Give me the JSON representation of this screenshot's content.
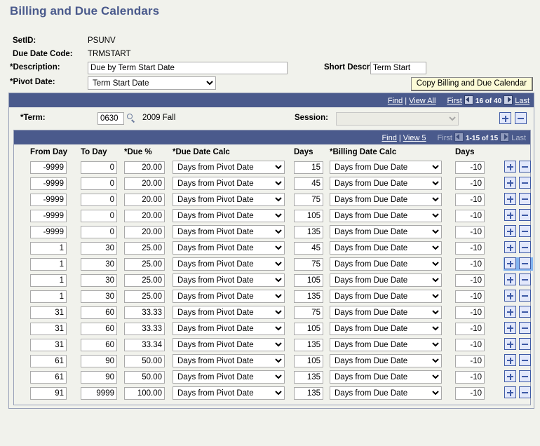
{
  "page": {
    "title": "Billing and Due Calendars"
  },
  "header": {
    "setid_label": "SetID:",
    "setid_value": "PSUNV",
    "due_date_code_label": "Due Date Code:",
    "due_date_code_value": "TRMSTART",
    "description_label": "*Description:",
    "description_value": "Due by Term Start Date",
    "short_description_label": "Short Description:",
    "short_description_value": "Term Start",
    "pivot_date_label": "*Pivot Date:",
    "pivot_date_value": "Term Start Date",
    "pivot_date_options": [
      "Term Start Date"
    ],
    "copy_button_label": "Copy Billing and Due Calendar"
  },
  "outer_nav": {
    "find_label": "Find",
    "separator": "|",
    "view_all_label": "View All",
    "first_label": "First",
    "prev_icon": "prev-arrow-icon",
    "count_label": "16 of 40",
    "next_icon": "next-arrow-icon",
    "last_label": "Last"
  },
  "term_row": {
    "term_label": "*Term:",
    "term_value": "0630",
    "lookup_icon": "magnifier-icon",
    "term_description": "2009 Fall",
    "session_label": "Session:",
    "session_value": "",
    "session_options": [
      ""
    ],
    "add_row_icon": "plus-icon",
    "delete_row_icon": "minus-icon"
  },
  "inner_nav": {
    "find_label": "Find",
    "separator": "|",
    "view_label": "View 5",
    "first_label": "First",
    "prev_icon": "prev-arrow-icon",
    "count_label": "1-15 of 15",
    "next_icon": "next-arrow-icon",
    "last_label": "Last"
  },
  "grid": {
    "columns": [
      "From Day",
      "To Day",
      "*Due %",
      "*Due Date Calc",
      "Days",
      "*Billing Date Calc",
      "Days"
    ],
    "due_date_calc_options": [
      "Days from Pivot Date"
    ],
    "billing_date_calc_options": [
      "Days from Due Date"
    ],
    "add_row_icon": "plus-icon",
    "delete_row_icon": "minus-icon",
    "active_row_index": 6,
    "rows": [
      {
        "from_day": "-9999",
        "to_day": "0",
        "due_pct": "20.00",
        "due_date_calc": "Days from Pivot Date",
        "days": "15",
        "billing_date_calc": "Days from Due Date",
        "billing_days": "-10"
      },
      {
        "from_day": "-9999",
        "to_day": "0",
        "due_pct": "20.00",
        "due_date_calc": "Days from Pivot Date",
        "days": "45",
        "billing_date_calc": "Days from Due Date",
        "billing_days": "-10"
      },
      {
        "from_day": "-9999",
        "to_day": "0",
        "due_pct": "20.00",
        "due_date_calc": "Days from Pivot Date",
        "days": "75",
        "billing_date_calc": "Days from Due Date",
        "billing_days": "-10"
      },
      {
        "from_day": "-9999",
        "to_day": "0",
        "due_pct": "20.00",
        "due_date_calc": "Days from Pivot Date",
        "days": "105",
        "billing_date_calc": "Days from Due Date",
        "billing_days": "-10"
      },
      {
        "from_day": "-9999",
        "to_day": "0",
        "due_pct": "20.00",
        "due_date_calc": "Days from Pivot Date",
        "days": "135",
        "billing_date_calc": "Days from Due Date",
        "billing_days": "-10"
      },
      {
        "from_day": "1",
        "to_day": "30",
        "due_pct": "25.00",
        "due_date_calc": "Days from Pivot Date",
        "days": "45",
        "billing_date_calc": "Days from Due Date",
        "billing_days": "-10"
      },
      {
        "from_day": "1",
        "to_day": "30",
        "due_pct": "25.00",
        "due_date_calc": "Days from Pivot Date",
        "days": "75",
        "billing_date_calc": "Days from Due Date",
        "billing_days": "-10"
      },
      {
        "from_day": "1",
        "to_day": "30",
        "due_pct": "25.00",
        "due_date_calc": "Days from Pivot Date",
        "days": "105",
        "billing_date_calc": "Days from Due Date",
        "billing_days": "-10"
      },
      {
        "from_day": "1",
        "to_day": "30",
        "due_pct": "25.00",
        "due_date_calc": "Days from Pivot Date",
        "days": "135",
        "billing_date_calc": "Days from Due Date",
        "billing_days": "-10"
      },
      {
        "from_day": "31",
        "to_day": "60",
        "due_pct": "33.33",
        "due_date_calc": "Days from Pivot Date",
        "days": "75",
        "billing_date_calc": "Days from Due Date",
        "billing_days": "-10"
      },
      {
        "from_day": "31",
        "to_day": "60",
        "due_pct": "33.33",
        "due_date_calc": "Days from Pivot Date",
        "days": "105",
        "billing_date_calc": "Days from Due Date",
        "billing_days": "-10"
      },
      {
        "from_day": "31",
        "to_day": "60",
        "due_pct": "33.34",
        "due_date_calc": "Days from Pivot Date",
        "days": "135",
        "billing_date_calc": "Days from Due Date",
        "billing_days": "-10"
      },
      {
        "from_day": "61",
        "to_day": "90",
        "due_pct": "50.00",
        "due_date_calc": "Days from Pivot Date",
        "days": "105",
        "billing_date_calc": "Days from Due Date",
        "billing_days": "-10"
      },
      {
        "from_day": "61",
        "to_day": "90",
        "due_pct": "50.00",
        "due_date_calc": "Days from Pivot Date",
        "days": "135",
        "billing_date_calc": "Days from Due Date",
        "billing_days": "-10"
      },
      {
        "from_day": "91",
        "to_day": "9999",
        "due_pct": "100.00",
        "due_date_calc": "Days from Pivot Date",
        "days": "135",
        "billing_date_calc": "Days from Due Date",
        "billing_days": "-10"
      }
    ]
  },
  "colors": {
    "header_bar": "#4a5a8c",
    "page_background": "#f1f2ec",
    "title": "#4a5a8c",
    "copy_button": "#fcfbd7",
    "pm_button_border": "#3e5aa6",
    "pm_button_active": "#82b4f0"
  }
}
